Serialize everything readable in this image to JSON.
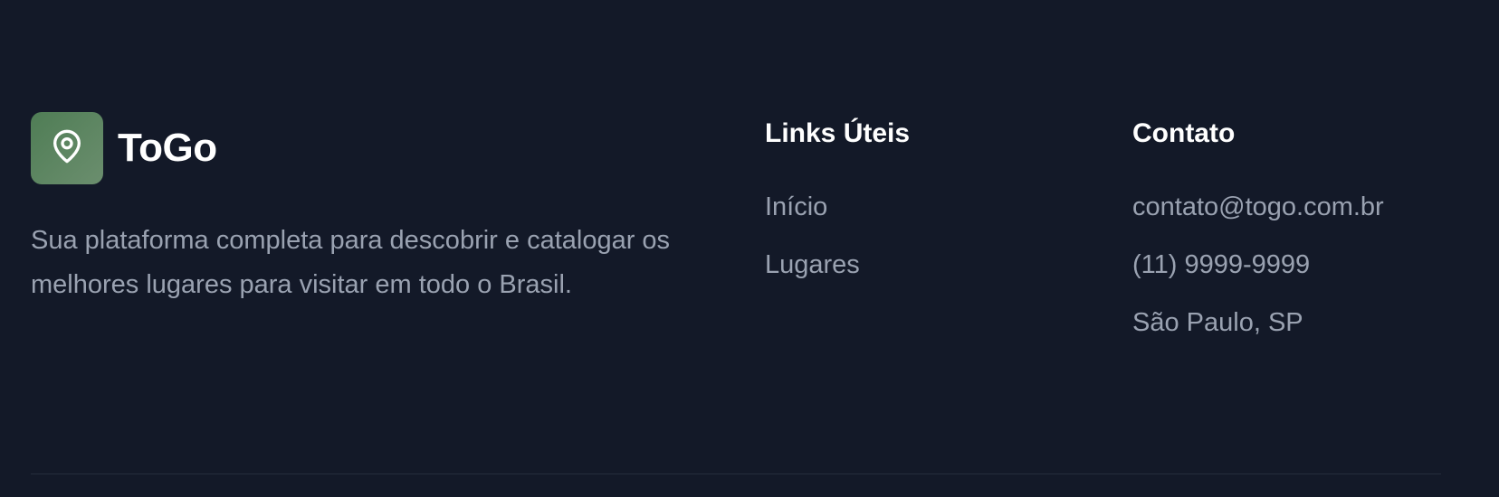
{
  "brand": {
    "name": "ToGo",
    "logo_icon": "map-pin-icon",
    "description": "Sua plataforma completa para descobrir e catalogar os melhores lugares para visitar em todo o Brasil."
  },
  "links": {
    "heading": "Links Úteis",
    "items": [
      {
        "label": "Início"
      },
      {
        "label": "Lugares"
      }
    ]
  },
  "contact": {
    "heading": "Contato",
    "items": [
      {
        "label": "contato@togo.com.br"
      },
      {
        "label": "(11) 9999-9999"
      },
      {
        "label": "São Paulo, SP"
      }
    ]
  },
  "colors": {
    "background": "#131928",
    "logo_bg": "#5b8560",
    "heading": "#ffffff",
    "muted_text": "#9aa2b1"
  }
}
